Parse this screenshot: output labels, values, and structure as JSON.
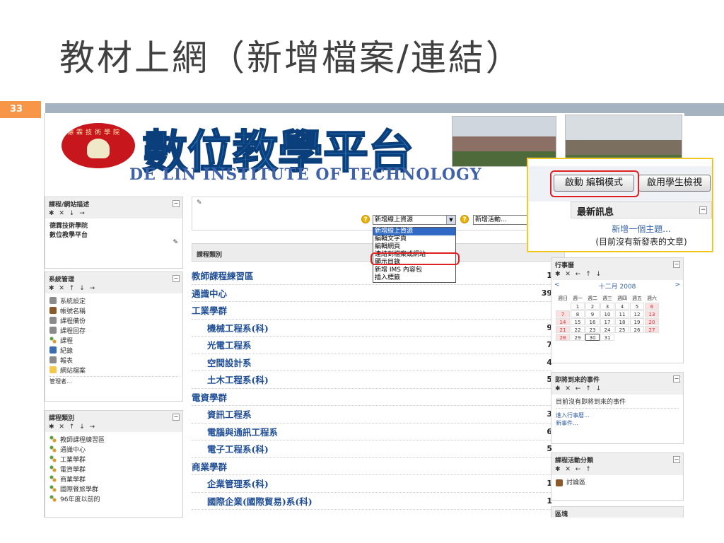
{
  "slide": {
    "title": "教材上網（新增檔案/連結）",
    "number": "33"
  },
  "banner": {
    "logo_ring": "德霖技術學院",
    "logo_title": "數位教學平台",
    "logo_en": "DE LIN INSTITUTE OF TECHNOLOGY"
  },
  "left": {
    "desc_block": {
      "title": "課程/網站描述",
      "controls": "✱ ✕ ↓ →",
      "lines": [
        "德霖技術學院",
        "數位教學平台"
      ]
    },
    "admin_block": {
      "title": "系統管理",
      "controls": "✱ ✕ ↑ ↓ →",
      "items": [
        {
          "label": "系統設定",
          "icon": "tools-icon"
        },
        {
          "label": "帳號名稱",
          "icon": "users-icon"
        },
        {
          "label": "課程備份",
          "icon": "backup-icon"
        },
        {
          "label": "課程回存",
          "icon": "restore-icon"
        },
        {
          "label": "課程",
          "icon": "course-icon"
        },
        {
          "label": "紀錄",
          "icon": "log-icon"
        },
        {
          "label": "報表",
          "icon": "report-icon"
        },
        {
          "label": "網站檔案",
          "icon": "folder-icon"
        }
      ],
      "footer": "管理者..."
    },
    "category_block": {
      "title": "課程類別",
      "controls": "✱ ✕ ↑ ↓ →",
      "items": [
        "教師課程練習區",
        "通識中心",
        "工業學群",
        "電資學群",
        "商業學群",
        "國際餐旅學群",
        "96年度以前的"
      ]
    }
  },
  "center": {
    "resource_select_value": "新增線上資源",
    "activity_select_value": "新增活動...",
    "dropdown_options": [
      "新增線上資源",
      "編輯文字頁",
      "編輯網頁",
      "連結到檔案或網站",
      "顯示目錄",
      "新增 IMS 內容包",
      "插入標籤"
    ],
    "category_header": "課程類別",
    "categories": [
      {
        "name": "教師課程練習區",
        "count": "1",
        "sub": false
      },
      {
        "name": "通識中心",
        "count": "39",
        "sub": false
      },
      {
        "name": "工業學群",
        "count": "",
        "sub": false
      },
      {
        "name": "機械工程系(科)",
        "count": "9",
        "sub": true
      },
      {
        "name": "光電工程系",
        "count": "7",
        "sub": true
      },
      {
        "name": "空間設計系",
        "count": "4",
        "sub": true
      },
      {
        "name": "土木工程系(科)",
        "count": "5",
        "sub": true
      },
      {
        "name": "電資學群",
        "count": "",
        "sub": false
      },
      {
        "name": "資訊工程系",
        "count": "3",
        "sub": true
      },
      {
        "name": "電腦與通訊工程系",
        "count": "6",
        "sub": true
      },
      {
        "name": "電子工程系(科)",
        "count": "5",
        "sub": true
      },
      {
        "name": "商業學群",
        "count": "",
        "sub": false
      },
      {
        "name": "企業管理系(科)",
        "count": "1",
        "sub": true
      },
      {
        "name": "國際企業(國際貿易)系(科)",
        "count": "1",
        "sub": true
      }
    ]
  },
  "right": {
    "calendar": {
      "title": "行事曆",
      "controls": "✱ ✕ ← ↑ ↓",
      "prev": "<",
      "month": "十二月 2008",
      "next": ">",
      "dow": [
        "週日",
        "週一",
        "週二",
        "週三",
        "週四",
        "週五",
        "週六"
      ],
      "weeks": [
        [
          "",
          "1",
          "2",
          "3",
          "4",
          "5",
          "6"
        ],
        [
          "7",
          "8",
          "9",
          "10",
          "11",
          "12",
          "13"
        ],
        [
          "14",
          "15",
          "16",
          "17",
          "18",
          "19",
          "20"
        ],
        [
          "21",
          "22",
          "23",
          "24",
          "25",
          "26",
          "27"
        ],
        [
          "28",
          "29",
          "30",
          "31",
          "",
          "",
          ""
        ]
      ],
      "today": "30"
    },
    "upcoming": {
      "title": "即將到來的事件",
      "controls": "✱ ✕ ← ↑ ↓",
      "empty": "目前沒有即將到來的事件",
      "link1": "進入行事曆...",
      "link2": "新事件..."
    },
    "activities": {
      "title": "課程活動分類",
      "controls": "✱ ✕ ← ↑",
      "item": "討論區"
    },
    "blocks_title": "區塊"
  },
  "popup": {
    "edit_button": "啟動 編輯模式",
    "student_button": "啟用學生檢視",
    "news_title": "最新訊息",
    "news_link": "新增一個主題...",
    "news_empty": "(目前沒有新發表的文章)"
  },
  "colors": {
    "accent_orange": "#f79646",
    "highlight_red": "#e02020",
    "link_blue": "#1f4e96"
  }
}
